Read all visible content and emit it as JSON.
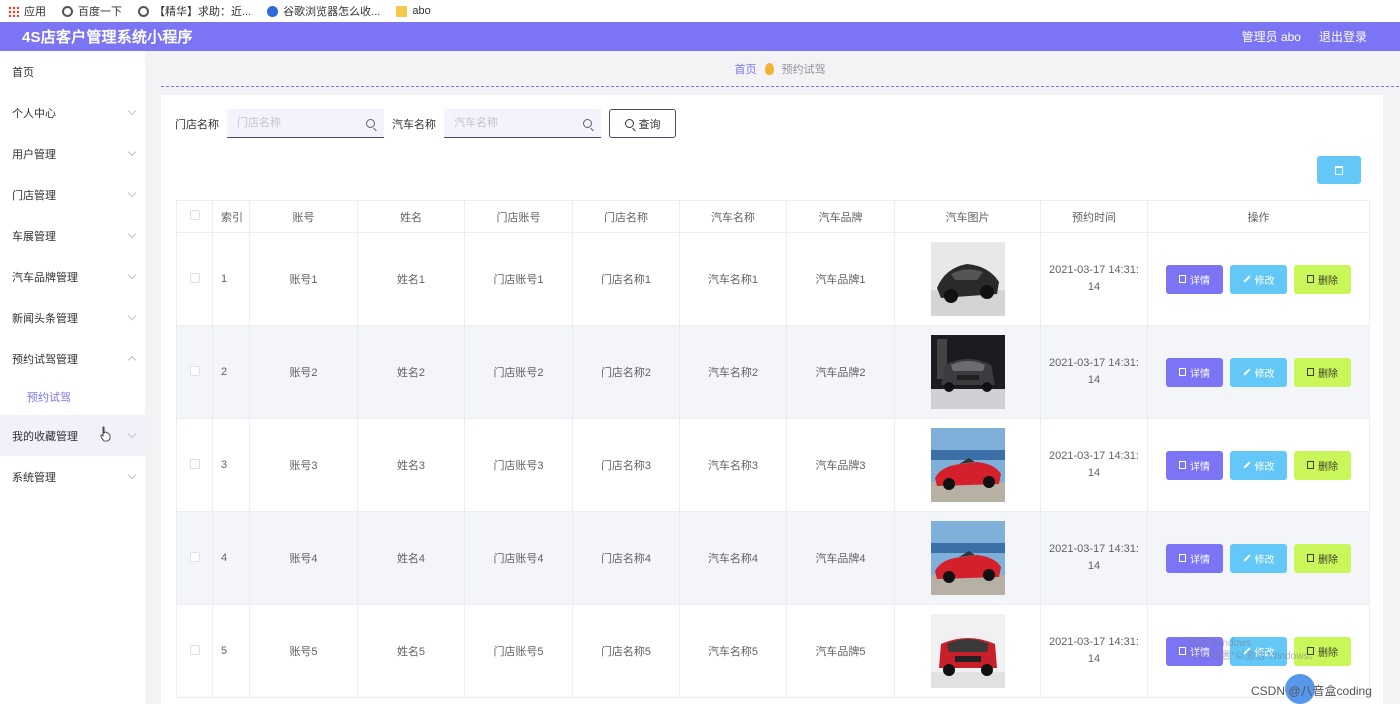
{
  "bookmarks": [
    {
      "icon": "apps-icon",
      "label": "应用"
    },
    {
      "icon": "globe-icon",
      "label": "百度一下"
    },
    {
      "icon": "globe-icon",
      "label": "【精华】求助：近..."
    },
    {
      "icon": "paw-icon",
      "label": "谷歌浏览器怎么收..."
    },
    {
      "icon": "folder-icon",
      "label": "abo"
    }
  ],
  "header": {
    "title": "4S店客户管理系统小程序",
    "user": "管理员 abo",
    "logout": "退出登录",
    "color": "#7b75f5"
  },
  "sidebar": {
    "items": [
      {
        "label": "首页",
        "chevron": false
      },
      {
        "label": "个人中心",
        "chevron": true
      },
      {
        "label": "用户管理",
        "chevron": true
      },
      {
        "label": "门店管理",
        "chevron": true
      },
      {
        "label": "车展管理",
        "chevron": true
      },
      {
        "label": "汽车品牌管理",
        "chevron": true
      },
      {
        "label": "新闻头条管理",
        "chevron": true
      },
      {
        "label": "预约试驾管理",
        "chevron": true,
        "expanded": true
      }
    ],
    "sub_item": "预约试驾",
    "items_after": [
      {
        "label": "我的收藏管理",
        "chevron": true,
        "hover": true
      },
      {
        "label": "系统管理",
        "chevron": true
      }
    ]
  },
  "breadcrumb": {
    "home": "首页",
    "current": "预约试驾"
  },
  "search": {
    "store_label": "门店名称",
    "store_placeholder": "门店名称",
    "car_label": "汽车名称",
    "car_placeholder": "汽车名称",
    "query_label": "查询"
  },
  "table": {
    "headers": [
      "索引",
      "账号",
      "姓名",
      "门店账号",
      "门店名称",
      "汽车名称",
      "汽车品牌",
      "汽车图片",
      "预约时间",
      "操作"
    ],
    "actions": {
      "detail": "详情",
      "edit": "修改",
      "delete": "删除"
    },
    "rows": [
      {
        "index": "1",
        "account": "账号1",
        "name": "姓名1",
        "store_account": "门店账号1",
        "store_name": "门店名称1",
        "car_name": "汽车名称1",
        "brand": "汽车品牌1",
        "time_a": "2021-03-17 14:31:",
        "time_b": "14",
        "car": "dark-sports"
      },
      {
        "index": "2",
        "account": "账号2",
        "name": "姓名2",
        "store_account": "门店账号2",
        "store_name": "门店名称2",
        "car_name": "汽车名称2",
        "brand": "汽车品牌2",
        "time_a": "2021-03-17 14:31:",
        "time_b": "14",
        "car": "dark-sedan"
      },
      {
        "index": "3",
        "account": "账号3",
        "name": "姓名3",
        "store_account": "门店账号3",
        "store_name": "门店名称3",
        "car_name": "汽车名称3",
        "brand": "汽车品牌3",
        "time_a": "2021-03-17 14:31:",
        "time_b": "14",
        "car": "red-convertible"
      },
      {
        "index": "4",
        "account": "账号4",
        "name": "姓名4",
        "store_account": "门店账号4",
        "store_name": "门店名称4",
        "car_name": "汽车名称4",
        "brand": "汽车品牌4",
        "time_a": "2021-03-17 14:31:",
        "time_b": "14",
        "car": "red-convertible"
      },
      {
        "index": "5",
        "account": "账号5",
        "name": "姓名5",
        "store_account": "门店账号5",
        "store_name": "门店名称5",
        "car_name": "汽车名称5",
        "brand": "汽车品牌5",
        "time_a": "2021-03-17 14:31:",
        "time_b": "14",
        "car": "red-suv"
      }
    ]
  },
  "overlay": {
    "watermark_line1": "激活 Windows",
    "watermark_line2": "转到\"设置\"以激活 Windows。",
    "csdn": "CSDN @八音盒coding"
  }
}
